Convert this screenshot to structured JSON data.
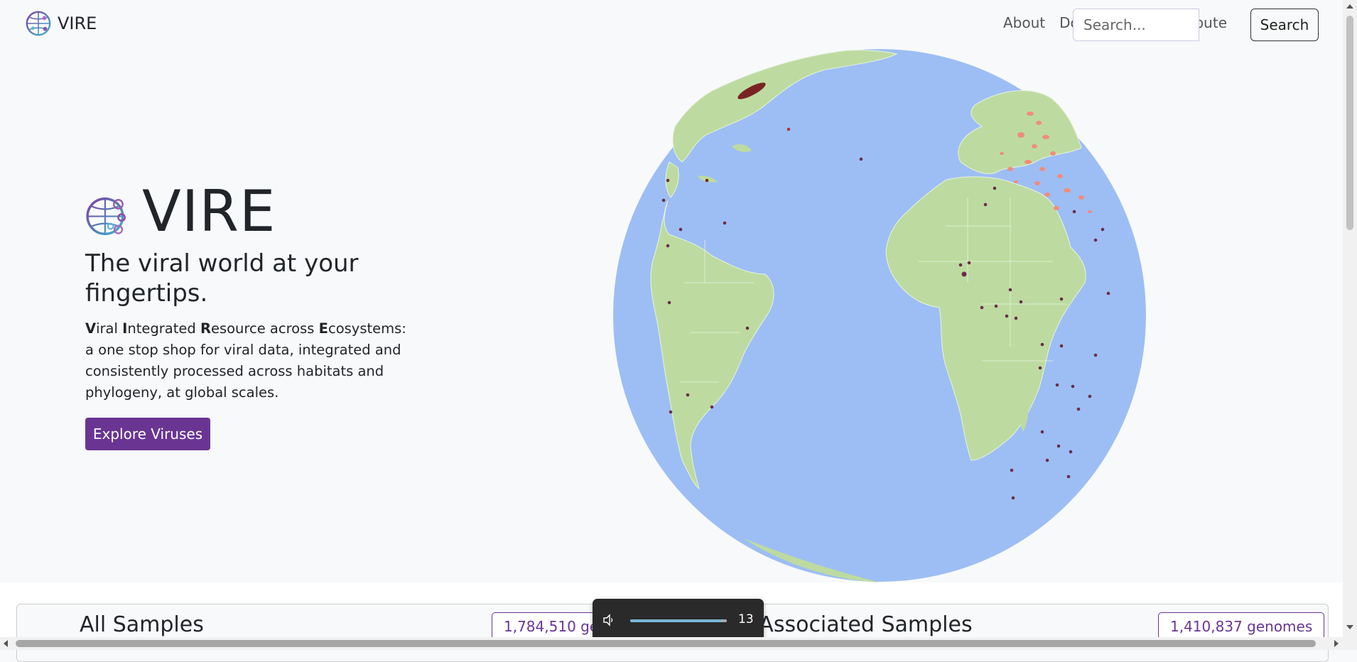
{
  "nav": {
    "brand": "VIRE",
    "links": [
      "About",
      "Downloads",
      "Contribute"
    ],
    "search_placeholder": "Search...",
    "search_button": "Search"
  },
  "hero": {
    "title": "VIRE",
    "tagline": "The viral world at your fingertips.",
    "description": {
      "v": "V",
      "v_rest": "iral ",
      "i": "I",
      "i_rest": "ntegrated ",
      "r": "R",
      "r_rest": "esource across ",
      "e": "E",
      "e_rest": "cosystems: a one stop shop for viral data, integrated and consistently processed across habitats and phylogeny, at global scales."
    },
    "cta": "Explore Viruses"
  },
  "globe": {
    "icon": "globe-map",
    "colors": {
      "ocean": "#9dbef4",
      "land": "#bddba0",
      "sample_point": "#6b2d4a",
      "hotspot": "#f08c7c"
    }
  },
  "samples": {
    "all": {
      "title": "All Samples",
      "count": "1,784,510 genomes"
    },
    "host": {
      "title": "Host–Associated Samples",
      "count": "1,410,837 genomes"
    }
  },
  "media_overlay": {
    "icon": "speaker-icon",
    "volume": 13,
    "volume_fraction": 0.13
  },
  "colors": {
    "brand": "#6a3592",
    "background": "#f8f9fa"
  }
}
